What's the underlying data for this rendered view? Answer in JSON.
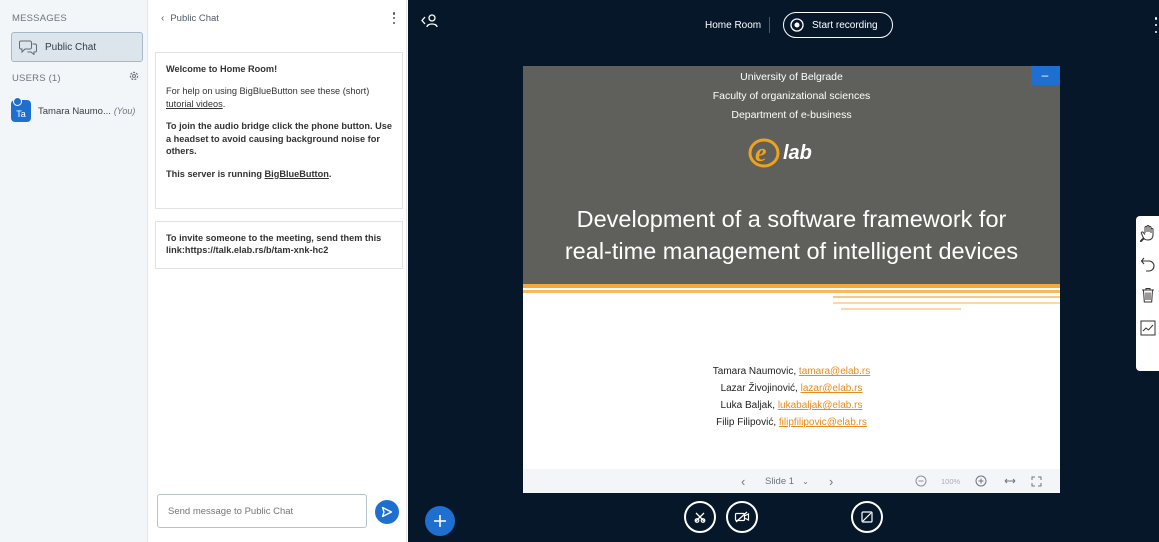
{
  "userlist": {
    "messages_title": "MESSAGES",
    "public_chat_label": "Public Chat",
    "users_title": "USERS (1)",
    "user": {
      "initials": "Ta",
      "name": "Tamara Naumo...",
      "you_tag": "(You)"
    }
  },
  "chat": {
    "header_title": "Public Chat",
    "welcome": {
      "line1_prefix": "Welcome to ",
      "line1_room": "Home Room",
      "line1_suffix": "!",
      "help_prefix": "For help on using BigBlueButton see these (short) ",
      "help_link": "tutorial videos",
      "help_suffix": ".",
      "audio_text": "To join the audio bridge click the phone button. Use a headset to avoid causing background noise for others.",
      "server_prefix": "This server is running ",
      "server_link": "BigBlueButton",
      "server_suffix": "."
    },
    "invite_text": "To invite someone to the meeting, send them this link:https://talk.elab.rs/b/tam-xnk-hc2",
    "input_placeholder": "Send message to Public Chat"
  },
  "main": {
    "room_name": "Home Room",
    "record_label": "Start recording",
    "slide": {
      "uni_line1": "University of Belgrade",
      "uni_line2": "Faculty of organizational sciences",
      "uni_line3": "Department of e-business",
      "logo_text": "lab",
      "title_line1": "Development of a software framework for",
      "title_line2": "real-time management of intelligent devices",
      "authors": [
        {
          "name": "Tamara Naumovic, ",
          "email": "tamara@elab.rs"
        },
        {
          "name": "Lazar Živojinović, ",
          "email": "lazar@elab.rs"
        },
        {
          "name": "Luka Baljak, ",
          "email": "lukabaljak@elab.rs"
        },
        {
          "name": "Filip Filipović, ",
          "email": "filipfilipovic@elab.rs"
        }
      ],
      "minimize_label": "–"
    },
    "controls": {
      "slide_label": "Slide 1",
      "zoom_label": "100%"
    }
  },
  "colors": {
    "accent": "#1f6fd1",
    "main_bg": "#06172a",
    "slide_header_bg": "#5f5f5b",
    "orange": "#e98a1b"
  }
}
